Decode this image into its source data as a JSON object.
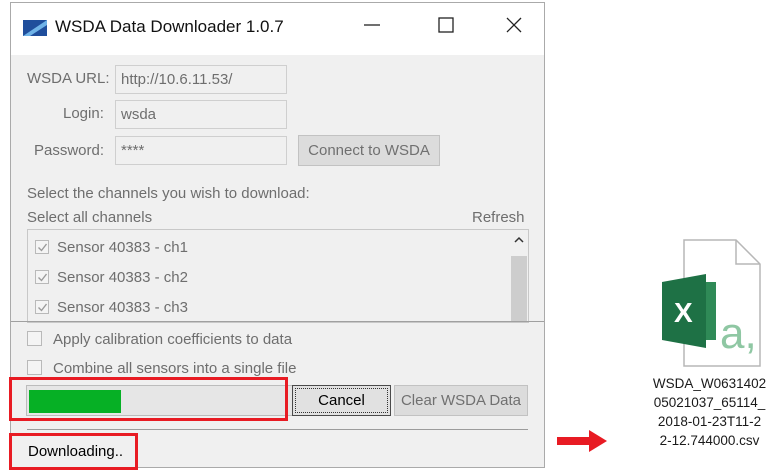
{
  "window": {
    "title": "WSDA Data Downloader 1.0.7",
    "icon": "app-logo-icon",
    "controls": [
      "minimize-icon",
      "maximize-icon",
      "close-icon"
    ]
  },
  "connection": {
    "url_label": "WSDA URL:",
    "url_value": "http://10.6.11.53/",
    "login_label": "Login:",
    "login_value": "wsda",
    "password_label": "Password:",
    "password_value": "****",
    "connect_button": "Connect to WSDA"
  },
  "channels": {
    "prompt": "Select the channels you wish to download:",
    "select_all": "Select all channels",
    "refresh": "Refresh",
    "items": [
      {
        "label": "Sensor 40383 - ch1",
        "checked": true
      },
      {
        "label": "Sensor 40383 - ch2",
        "checked": true
      },
      {
        "label": "Sensor 40383 - ch3",
        "checked": true
      }
    ]
  },
  "options": {
    "apply_calibration": "Apply calibration coefficients to data",
    "combine_sensors": "Combine all sensors into a single file"
  },
  "progress": {
    "value_fraction": 0.35,
    "color": "#06b025"
  },
  "buttons": {
    "cancel": "Cancel",
    "clear": "Clear WSDA Data"
  },
  "status": "Downloading..",
  "annotations": {
    "highlight_color": "#e81b23"
  },
  "output_file": {
    "icon": "excel-csv-file-icon",
    "name_lines": [
      "WSDA_W0631402",
      "05021037_65114_",
      "2018-01-23T11-2",
      "2-12.744000.csv"
    ]
  }
}
